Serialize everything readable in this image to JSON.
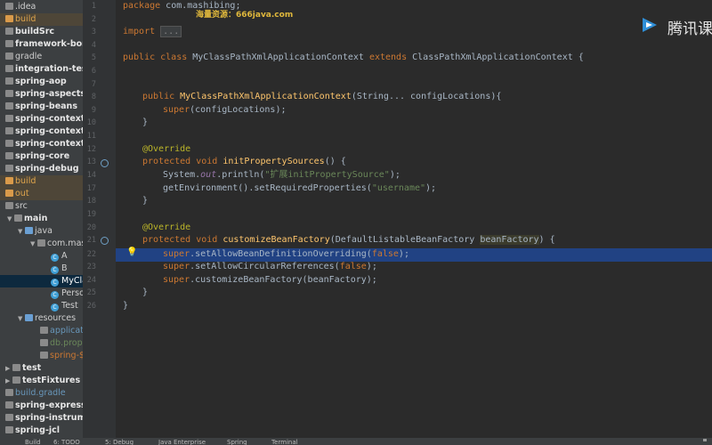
{
  "project_tree": {
    "rows": [
      {
        "label": ".idea",
        "style": "folder"
      },
      {
        "label": "build",
        "style": "excluded"
      },
      {
        "label": "buildSrc",
        "style": "bold"
      },
      {
        "label": "framework-bom",
        "style": "bold"
      },
      {
        "label": "gradle",
        "style": "folder"
      },
      {
        "label": "integration-tests",
        "style": "bold"
      },
      {
        "label": "spring-aop",
        "style": "bold"
      },
      {
        "label": "spring-aspects",
        "style": "bold"
      },
      {
        "label": "spring-beans",
        "style": "bold"
      },
      {
        "label": "spring-context",
        "style": "bold"
      },
      {
        "label": "spring-context-indexer",
        "style": "bold"
      },
      {
        "label": "spring-context-support",
        "style": "bold"
      },
      {
        "label": "spring-core",
        "style": "bold"
      },
      {
        "label": "spring-debug",
        "style": "bold"
      },
      {
        "label": "build",
        "style": "excluded-indent"
      },
      {
        "label": "out",
        "style": "excluded-indent"
      },
      {
        "label": "src",
        "style": "src"
      },
      {
        "label": "main",
        "style": "main"
      },
      {
        "label": "java",
        "style": "java"
      },
      {
        "label": "com.mashibing",
        "style": "pkg"
      },
      {
        "label": "A",
        "style": "class"
      },
      {
        "label": "B",
        "style": "class"
      },
      {
        "label": "MyClassPathXmlApplicationContext",
        "style": "class-selected"
      },
      {
        "label": "Person",
        "style": "class"
      },
      {
        "label": "Test",
        "style": "class"
      },
      {
        "label": "resources",
        "style": "resources"
      },
      {
        "label": "application.xml",
        "style": "res-blue"
      },
      {
        "label": "db.properties",
        "style": "res-green"
      },
      {
        "label": "spring-${username}.xml",
        "style": "res-red"
      },
      {
        "label": "test",
        "style": "test"
      },
      {
        "label": "testFixtures",
        "style": "test"
      },
      {
        "label": "build.gradle",
        "style": "gradle"
      },
      {
        "label": "spring-expression",
        "style": "bold"
      },
      {
        "label": "spring-instrument",
        "style": "bold"
      },
      {
        "label": "spring-jcl",
        "style": "bold"
      }
    ]
  },
  "gutter": {
    "line_numbers": [
      "1",
      "2",
      "3",
      "",
      "",
      "",
      "",
      "",
      "",
      "",
      "",
      "",
      "",
      "14",
      "17",
      "18",
      "19",
      "20",
      "",
      "",
      "21",
      "22",
      "23",
      "24",
      "25"
    ],
    "run_icon_lines": [
      "14",
      "20"
    ]
  },
  "code": {
    "line_package_kw": "package",
    "line_package_name": " com.mashibing;",
    "line_import_kw": "import",
    "line_import_fold": "...",
    "line_class_kw1": "public class",
    "line_class_name": " MyClassPathXmlApplicationContext ",
    "line_class_kw2": "extends",
    "line_class_rest": " ClassPathXmlApplicationContext {",
    "ctor_kw": "public",
    "ctor_name": " MyClassPathXmlApplicationContext",
    "ctor_params": "(String... configLocations){",
    "super_kw": "super",
    "super_args": "(configLocations);",
    "close1": "}",
    "override1": "@Override",
    "init_kw": "protected void",
    "init_name": " initPropertySources",
    "init_rest": "() {",
    "sysout_a": "System.",
    "sysout_out": "out",
    "sysout_b": ".println(",
    "sysout_str": "\"扩展initPropertySource\"",
    "sysout_c": ");",
    "getenv_a": "getEnvironment().setRequiredProperties(",
    "getenv_str": "\"username\"",
    "getenv_c": ");",
    "close2": "}",
    "override2": "@Override",
    "cbf_kw": "protected void",
    "cbf_name": " customizeBeanFactory",
    "cbf_params": "(DefaultListableBeanFactory ",
    "cbf_param_name": "beanFactory",
    "cbf_rest": ") {",
    "s1_kw": "super",
    "s1_a": ".setAllowBeanDefinitionOverriding(",
    "s1_val": "false",
    "s1_c": ");",
    "s2_kw": "super",
    "s2_a": ".setAllowCircularReferences(",
    "s2_val": "false",
    "s2_c": ");",
    "s3_kw": "super",
    "s3_a": ".customizeBeanFactory(beanFactory);",
    "close3": "}",
    "close4": "}"
  },
  "watermark": "海量资源：666java.com",
  "brand": {
    "text": "腾讯课",
    "color": "#2f8fd8"
  },
  "bottom_bar": {
    "items": [
      "Build",
      "6: TODO",
      "5: Debug",
      "Java Enterprise",
      "Spring",
      "Terminal"
    ]
  }
}
